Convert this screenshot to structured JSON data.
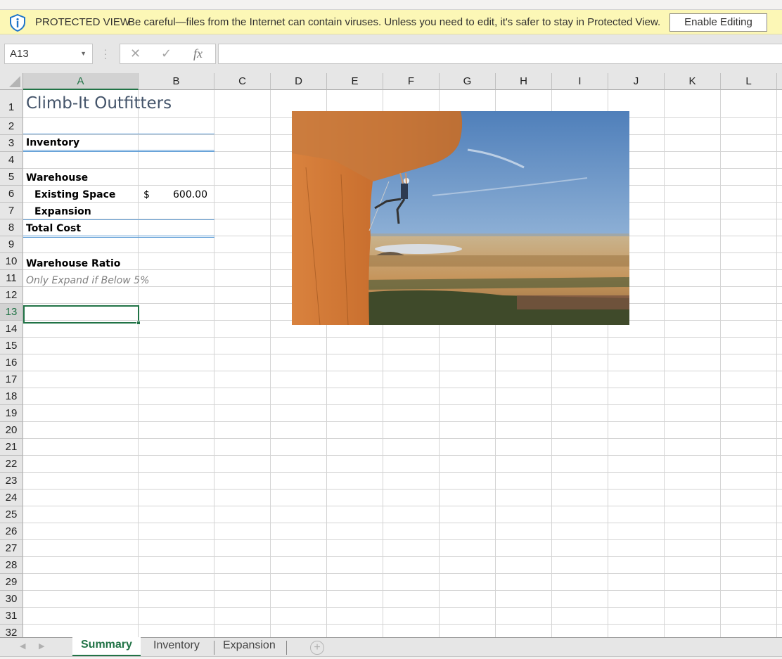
{
  "protected_view": {
    "title": "PROTECTED VIEW",
    "message": "Be careful—files from the Internet can contain viruses. Unless you need to edit, it's safer to stay in Protected View.",
    "enable_button": "Enable Editing",
    "icon": "shield-info-icon",
    "bar_color": "#fcf7b6"
  },
  "formula_bar": {
    "name_box": "A13",
    "cancel_icon": "✕",
    "enter_icon": "✓",
    "fx_label": "fx",
    "formula_value": ""
  },
  "columns": [
    "A",
    "B",
    "C",
    "D",
    "E",
    "F",
    "G",
    "H",
    "I",
    "J",
    "K",
    "L"
  ],
  "selected_column": "A",
  "rows": [
    "1",
    "2",
    "3",
    "4",
    "5",
    "6",
    "7",
    "8",
    "9",
    "10",
    "11",
    "12",
    "13",
    "14",
    "15",
    "16",
    "17",
    "18",
    "19",
    "20",
    "21",
    "22",
    "23",
    "24",
    "25",
    "26",
    "27",
    "28",
    "29",
    "30",
    "31",
    "32"
  ],
  "selected_row": "13",
  "cells": {
    "A1": "Climb-It Outfitters",
    "A3": "Inventory",
    "A5": "Warehouse",
    "A6": "Existing Space",
    "B6_currency": "$",
    "B6_value": "600.00",
    "A7": "Expansion",
    "A8": "Total Cost",
    "A10": "Warehouse Ratio",
    "A11": "Only Expand if Below 5%"
  },
  "image": {
    "description": "Rock climber hanging from overhanging orange cliff above flat farmland landscape under blue sky"
  },
  "sheet_tabs": [
    {
      "label": "Summary",
      "active": true
    },
    {
      "label": "Inventory",
      "active": false
    },
    {
      "label": "Expansion",
      "active": false
    }
  ],
  "add_sheet_icon": "+",
  "accent_color": "#217346"
}
